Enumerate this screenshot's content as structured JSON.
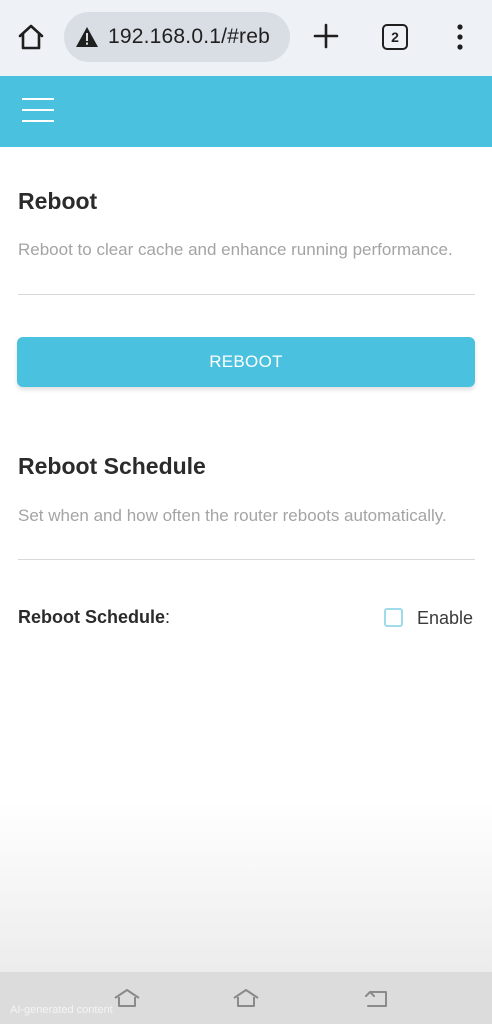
{
  "browser": {
    "url": "192.168.0.1/#reb",
    "tab_count": "2",
    "icons": [
      "home-icon",
      "warning-icon",
      "plus-icon",
      "tabs-icon",
      "more-vert-icon"
    ]
  },
  "colors": {
    "accent": "#4ac1df",
    "checkbox_border": "#9fdbea"
  },
  "reboot": {
    "title": "Reboot",
    "description": "Reboot to clear cache and enhance running performance.",
    "button_label": "REBOOT"
  },
  "schedule": {
    "title": "Reboot Schedule",
    "description": "Set when and how often the router reboots automatically.",
    "field_label": "Reboot Schedule",
    "field_suffix": ":",
    "checkbox_label": "Enable",
    "checked": false
  },
  "footer": {
    "note": "AI-generated content"
  }
}
